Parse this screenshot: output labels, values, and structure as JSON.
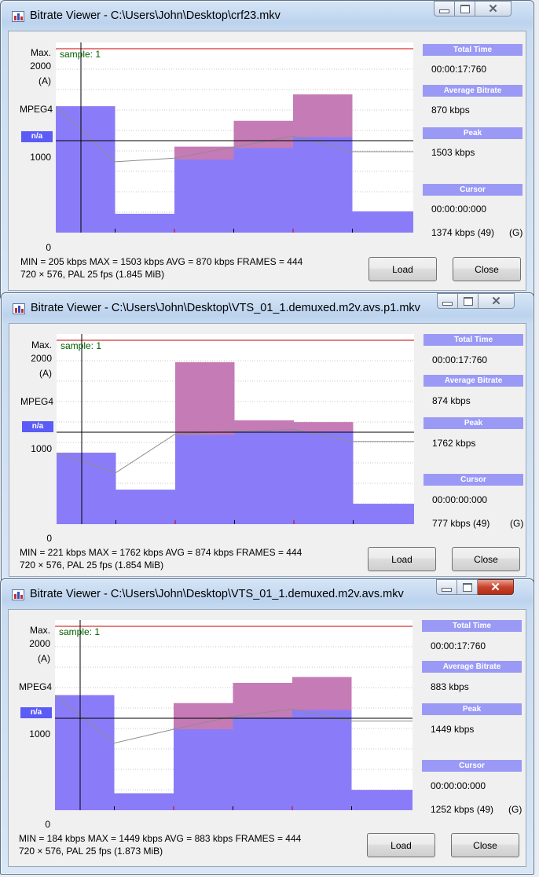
{
  "windows": [
    {
      "title": "Bitrate Viewer - C:\\Users\\John\\Desktop\\crf23.mkv",
      "active": false,
      "axis": {
        "max_label": "Max.",
        "max_value": "2000",
        "mode_label": "(A)",
        "codec": "MPEG4",
        "badge": "n/a",
        "mid_label": "1000",
        "zero_label": "0"
      },
      "sample_label": "sample: 1",
      "sidebar": {
        "total_time_header": "Total Time",
        "total_time": "00:00:17:760",
        "avg_header": "Average Bitrate",
        "avg": "870 kbps",
        "peak_header": "Peak",
        "peak": "1503 kbps",
        "cursor_header": "Cursor",
        "cursor_time": "00:00:00:000",
        "cursor_bitrate": "1374 kbps (49)",
        "cursor_flag": "(G)"
      },
      "stats_line1": "MIN = 205 kbps  MAX = 1503 kbps  AVG = 870 kbps  FRAMES = 444",
      "stats_line2": "720 × 576, PAL 25 fps     (1.845 MiB)",
      "load_label": "Load",
      "close_label": "Close",
      "chart_data": {
        "type": "bar",
        "y_range": [
          0,
          2000
        ],
        "peak_bars_kbps": [
          1374,
          205,
          935,
          1216,
          1503,
          230
        ],
        "avg_bars_kbps": [
          1374,
          205,
          795,
          920,
          1040,
          230
        ],
        "avg_line_kbps": [
          1374,
          770,
          810,
          930,
          1050,
          880,
          880
        ]
      }
    },
    {
      "title": "Bitrate Viewer - C:\\Users\\John\\Desktop\\VTS_01_1.demuxed.m2v.avs.p1.mkv",
      "active": false,
      "axis": {
        "max_label": "Max.",
        "max_value": "2000",
        "mode_label": "(A)",
        "codec": "MPEG4",
        "badge": "n/a",
        "mid_label": "1000",
        "zero_label": "0"
      },
      "sample_label": "sample: 1",
      "sidebar": {
        "total_time_header": "Total Time",
        "total_time": "00:00:17:760",
        "avg_header": "Average Bitrate",
        "avg": "874 kbps",
        "peak_header": "Peak",
        "peak": "1762 kbps",
        "cursor_header": "Cursor",
        "cursor_time": "00:00:00:000",
        "cursor_bitrate": "777 kbps (49)",
        "cursor_flag": "(G)"
      },
      "stats_line1": "MIN = 221 kbps  MAX = 1762 kbps  AVG = 874 kbps  FRAMES = 444",
      "stats_line2": "720 × 576, PAL 25 fps     (1.854 MiB)",
      "load_label": "Load",
      "close_label": "Close",
      "chart_data": {
        "type": "bar",
        "y_range": [
          0,
          2000
        ],
        "peak_bars_kbps": [
          777,
          375,
          1762,
          1130,
          1110,
          221
        ],
        "avg_bars_kbps": [
          777,
          375,
          970,
          1010,
          1010,
          221
        ],
        "avg_line_kbps": [
          777,
          560,
          980,
          1010,
          1030,
          900,
          900
        ]
      }
    },
    {
      "title": "Bitrate Viewer - C:\\Users\\John\\Desktop\\VTS_01_1.demuxed.m2v.avs.mkv",
      "active": true,
      "axis": {
        "max_label": "Max.",
        "max_value": "2000",
        "mode_label": "(A)",
        "codec": "MPEG4",
        "badge": "n/a",
        "mid_label": "1000",
        "zero_label": "0"
      },
      "sample_label": "sample: 1",
      "sidebar": {
        "total_time_header": "Total Time",
        "total_time": "00:00:17:760",
        "avg_header": "Average Bitrate",
        "avg": "883 kbps",
        "peak_header": "Peak",
        "peak": "1449 kbps",
        "cursor_header": "Cursor",
        "cursor_time": "00:00:00:000",
        "cursor_bitrate": "1252 kbps (49)",
        "cursor_flag": "(G)"
      },
      "stats_line1": "MIN = 184 kbps  MAX = 1449 kbps  AVG = 883 kbps  FRAMES = 444",
      "stats_line2": "720 × 576, PAL 25 fps     (1.873 MiB)",
      "load_label": "Load",
      "close_label": "Close",
      "chart_data": {
        "type": "bar",
        "y_range": [
          0,
          2000
        ],
        "peak_bars_kbps": [
          1252,
          184,
          1165,
          1385,
          1449,
          220
        ],
        "avg_bars_kbps": [
          1252,
          184,
          880,
          1010,
          1090,
          220
        ],
        "avg_line_kbps": [
          1252,
          730,
          880,
          1020,
          1100,
          970,
          970
        ]
      }
    }
  ]
}
